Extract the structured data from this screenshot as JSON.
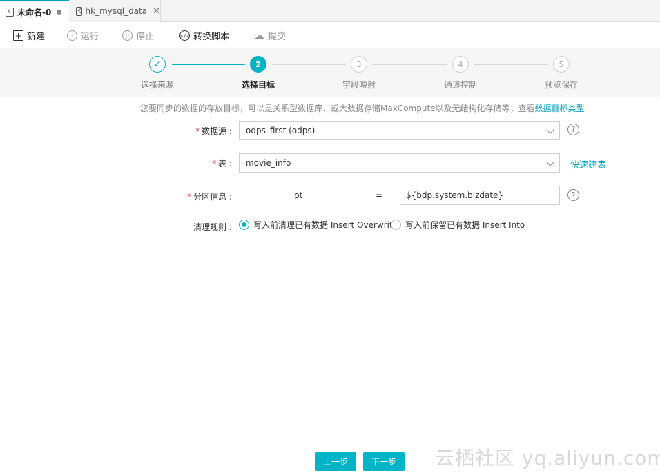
{
  "tabs": [
    {
      "label": "未命名-0",
      "active": true,
      "indicator": "unsaved-dot-icon"
    },
    {
      "label": "hk_mysql_data",
      "active": false,
      "indicator": "close-icon"
    }
  ],
  "toolbar": {
    "new_label": "新建",
    "run_label": "运行",
    "stop_label": "停止",
    "convert_label": "转换脚本",
    "submit_label": "提交"
  },
  "steps": [
    {
      "index": "✓",
      "label": "选择来源",
      "state": "done"
    },
    {
      "index": "2",
      "label": "选择目标",
      "state": "current"
    },
    {
      "index": "3",
      "label": "字段映射",
      "state": "todo"
    },
    {
      "index": "4",
      "label": "通道控制",
      "state": "todo"
    },
    {
      "index": "5",
      "label": "预览保存",
      "state": "todo"
    }
  ],
  "description": {
    "text": "您要同步的数据的存放目标，可以是关系型数据库，或大数据存储MaxCompute以及无结构化存储等；查看",
    "link": "数据目标类型"
  },
  "form": {
    "datasource": {
      "label": "数据源 :",
      "value": "odps_first (odps)"
    },
    "table": {
      "label": "表 :",
      "value": "movie_info",
      "quick_create": "快速建表"
    },
    "partition": {
      "label": "分区信息 :",
      "key": "pt",
      "eq": "=",
      "value": "${bdp.system.bizdate}"
    },
    "clean_rule": {
      "label": "清理规则 :",
      "options": [
        {
          "label": "写入前清理已有数据 Insert Overwrite",
          "checked": true
        },
        {
          "label": "写入前保留已有数据 Insert Into",
          "checked": false
        }
      ]
    }
  },
  "buttons": {
    "prev": "上一步",
    "next": "下一步"
  },
  "watermark": "云栖社区 yq.aliyun.com",
  "colors": {
    "accent": "#00b4c8",
    "link": "#00a6c0",
    "required": "#e04848"
  }
}
